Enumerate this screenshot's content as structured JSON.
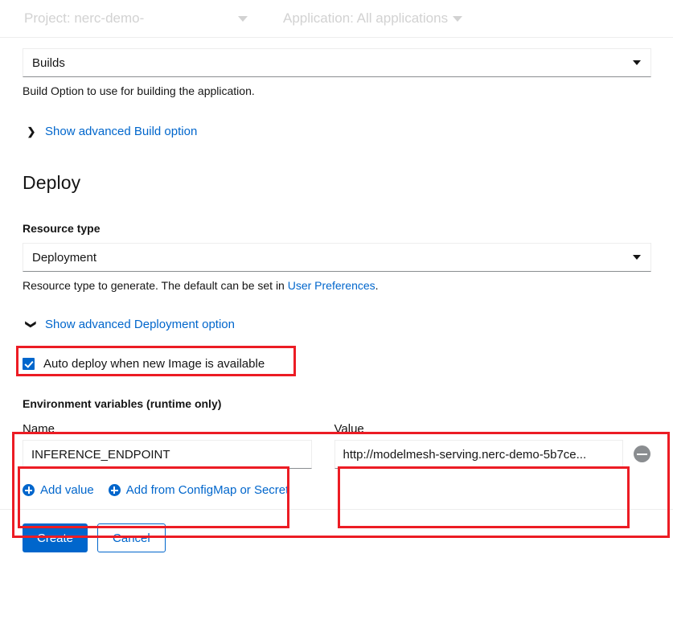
{
  "topbar": {
    "project_label": "Project: nerc-demo-",
    "application_label": "Application: All applications",
    "project_caret_icon": "caret-down-icon",
    "application_caret_icon": "caret-down-icon"
  },
  "build": {
    "select_value": "Builds",
    "select_caret_icon": "caret-down-icon",
    "help_text": "Build Option to use for building the application.",
    "advanced_toggle_label": "Show advanced Build option",
    "advanced_toggle_icon": "chevron-right-icon"
  },
  "deploy": {
    "heading": "Deploy",
    "resource_type_label": "Resource type",
    "resource_type_value": "Deployment",
    "resource_type_caret_icon": "caret-down-icon",
    "help_text_prefix": "Resource type to generate. The default can be set in ",
    "help_link": "User Preferences",
    "help_text_suffix": ".",
    "advanced_toggle_label": "Show advanced Deployment option",
    "advanced_toggle_icon": "chevron-down-icon",
    "auto_deploy_label": "Auto deploy when new Image is available",
    "auto_deploy_checked": "checked"
  },
  "env": {
    "section_title": "Environment variables (runtime only)",
    "name_label": "Name",
    "value_label": "Value",
    "rows": [
      {
        "name": "INFERENCE_ENDPOINT",
        "value": "http://modelmesh-serving.nerc-demo-5b7ce...",
        "remove_icon": "minus-circle-icon"
      }
    ],
    "add_value_label": "Add value",
    "add_value_icon": "plus-circle-icon",
    "add_configmap_label": "Add from ConfigMap or Secret",
    "add_configmap_icon": "plus-circle-icon"
  },
  "footer": {
    "create_label": "Create",
    "cancel_label": "Cancel"
  },
  "colors": {
    "accent_blue": "#0066cc",
    "annotation_red": "#ec1c24",
    "muted_gray": "#d2d2d2",
    "border_gray": "#ededed"
  }
}
